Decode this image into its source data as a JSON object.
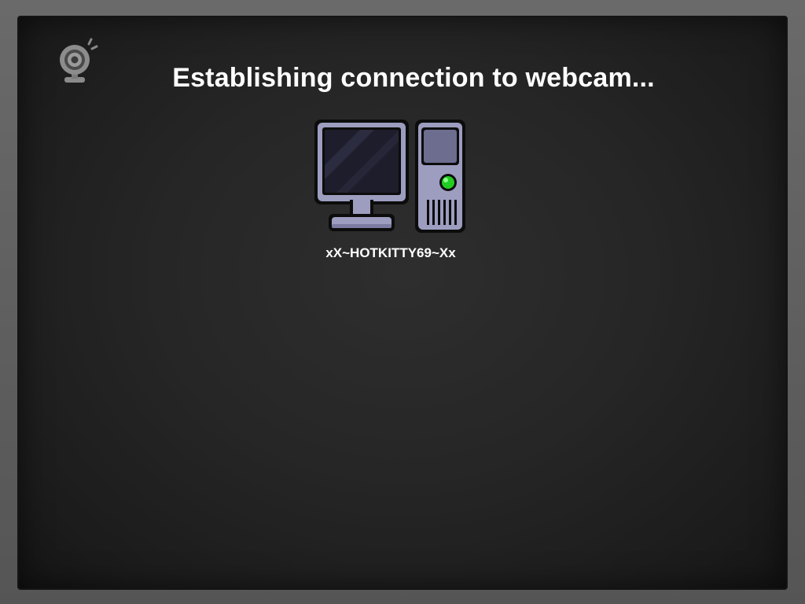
{
  "screen": {
    "title": "Establishing connection to webcam...",
    "peer_name": "xX~HOTKITTY69~Xx",
    "status_light_color": "#22cc22"
  },
  "icons": {
    "app_logo": "webcam-icon",
    "peer": "desktop-computer-icon"
  }
}
